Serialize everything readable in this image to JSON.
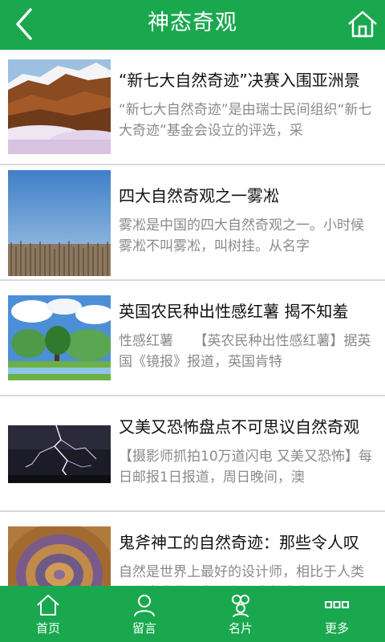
{
  "header": {
    "title": "神态奇观",
    "back_icon": "chevron-left-icon",
    "home_icon": "home-icon"
  },
  "articles": [
    {
      "title": "“新七大自然奇迹”决赛入围亚洲景",
      "desc": "“新七大自然奇迹”是由瑞士民间组织“新七大奇迹”基金会设立的评选，采",
      "image": "mountain-clouds-photo"
    },
    {
      "title": "四大自然奇观之一雾凇",
      "desc": "雾凇是中国的四大自然奇观之一。小时候雾凇不叫雾凇，叫树挂。从名字",
      "image": "rime-forest-photo"
    },
    {
      "title": "英国农民种出性感红薯 揭不知羞",
      "desc": "性感红薯　　【英农民种出性感红薯】据英国《镜报》报道，英国肯特",
      "image": "green-landscape-photo"
    },
    {
      "title": "又美又恐怖盘点不可思议自然奇观",
      "desc": "【摄影师抓拍10万道闪电 又美又恐怖】每日邮报1日报道，周日晚间，澳",
      "image": "lightning-storm-photo"
    },
    {
      "title": "鬼斧神工的自然奇迹：那些令人叹",
      "desc": "自然是世界上最好的设计师，相比于人类七大奇迹的巧夺天空，自然鬼身",
      "image": "sahara-eye-photo"
    }
  ],
  "tabbar": [
    {
      "label": "首页",
      "icon": "home-icon"
    },
    {
      "label": "留言",
      "icon": "user-icon"
    },
    {
      "label": "名片",
      "icon": "contacts-icon"
    },
    {
      "label": "更多",
      "icon": "more-dots-icon"
    }
  ],
  "colors": {
    "primary": "#1aa84f",
    "title_text": "#111111",
    "desc_text": "#8a8a8a",
    "divider": "#d9d9d9"
  }
}
